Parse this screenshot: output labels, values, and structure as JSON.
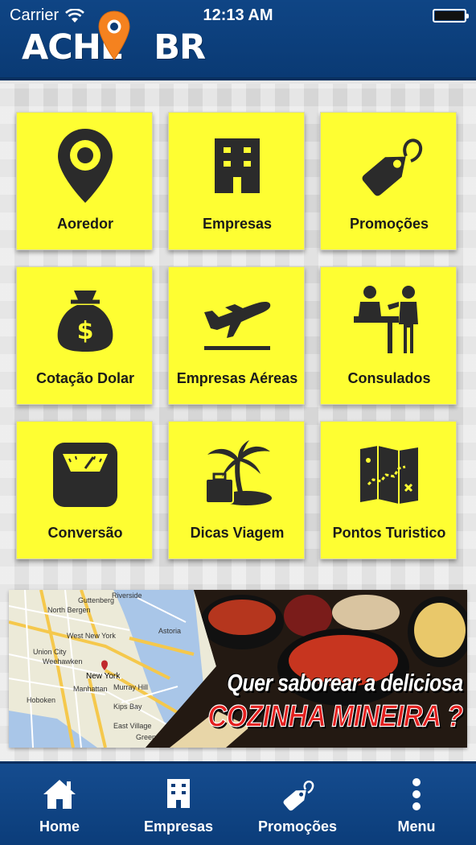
{
  "status_bar": {
    "carrier": "Carrier",
    "time": "12:13 AM"
  },
  "header": {
    "logo_text_left": "ACHE",
    "logo_text_right": "BR"
  },
  "grid": {
    "tiles": [
      {
        "label": "Aoredor",
        "icon": "location-pin-icon"
      },
      {
        "label": "Empresas",
        "icon": "building-icon"
      },
      {
        "label": "Promoções",
        "icon": "price-tag-icon"
      },
      {
        "label": "Cotação Dolar",
        "icon": "money-bag-icon"
      },
      {
        "label": "Empresas Aéreas",
        "icon": "airplane-takeoff-icon"
      },
      {
        "label": "Consulados",
        "icon": "consulate-desk-icon"
      },
      {
        "label": "Conversão",
        "icon": "scale-icon"
      },
      {
        "label": "Dicas Viagem",
        "icon": "palm-island-suitcase-icon"
      },
      {
        "label": "Pontos Turistico",
        "icon": "treasure-map-icon"
      }
    ]
  },
  "banner": {
    "line1": "Quer saborear a deliciosa",
    "line2": "COZINHA MINEIRA ?",
    "map_labels": [
      "North Bergen",
      "West New York",
      "Guttenberg",
      "Union City",
      "Weehawken",
      "Hoboken",
      "New York",
      "Manhattan",
      "Murray Hill",
      "Kips Bay",
      "East Village",
      "Greenpoint",
      "Astoria",
      "Riverside"
    ]
  },
  "tabbar": {
    "tabs": [
      {
        "label": "Home",
        "icon": "home-icon"
      },
      {
        "label": "Empresas",
        "icon": "building-icon"
      },
      {
        "label": "Promoções",
        "icon": "price-tag-icon"
      },
      {
        "label": "Menu",
        "icon": "more-vertical-icon"
      }
    ]
  },
  "colors": {
    "header_blue": "#0f4585",
    "tile_yellow": "#fefe32",
    "icon_dark": "#2b2b2b",
    "logo_pin_orange": "#f5821f",
    "banner_red": "#e3201f"
  }
}
